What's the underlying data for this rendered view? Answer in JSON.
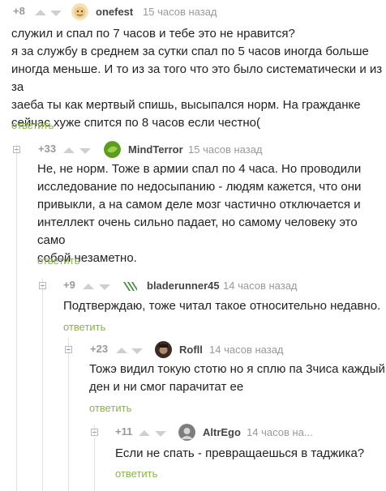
{
  "icons": {
    "collapse": "collapse-minus-icon",
    "up": "upvote-arrow-icon",
    "down": "downvote-arrow-icon"
  },
  "colors": {
    "reply_link": "#8ab24a",
    "rating": "#999999",
    "arrow": "#cfcfcf"
  },
  "comments": [
    {
      "rating": "+8",
      "nick": "onefest",
      "time": "15 часов назад",
      "lines": [
        "служил и спал по 7 часов и тебе это не нравится?",
        "я за службу в среднем за сутки спал по 5 часов иногда больше",
        "иногда меньше. И то из за того что это было систематически и из за",
        "заеба ты как мертвый спишь, высыпался норм. На гражданке",
        "сейчас хуже спится по 8 часов если честно("
      ],
      "reply": "ответить"
    },
    {
      "rating": "+33",
      "nick": "MindTerror",
      "time": "15 часов назад",
      "lines": [
        "Не, не норм. Тоже в армии спал по 4 часа. Но проводили",
        "исследование по недосыпанию - людям кажется, что они",
        "привыкли, а на самом деле мозг частично отключается и",
        "интеллект очень сильно падает, но самому человеку это само",
        "собой незаметно."
      ],
      "reply": "ответить"
    },
    {
      "rating": "+9",
      "nick": "bladerunner45",
      "time": "14 часов назад",
      "lines": [
        "Подтверждаю, тоже читал такое относительно недавно."
      ],
      "reply": "ответить"
    },
    {
      "rating": "+23",
      "nick": "Rofll",
      "time": "14 часов назад",
      "lines": [
        "Тожэ видил токую стотю но я сплю па 3чиса каждый",
        "ден и ни смог парачитат ее"
      ],
      "reply": "ответить"
    },
    {
      "rating": "+11",
      "nick": "AltrEgo",
      "time": "14 часов на...",
      "lines": [
        "Если не спать - превращаешься в таджика?"
      ],
      "reply": "ответить"
    }
  ]
}
